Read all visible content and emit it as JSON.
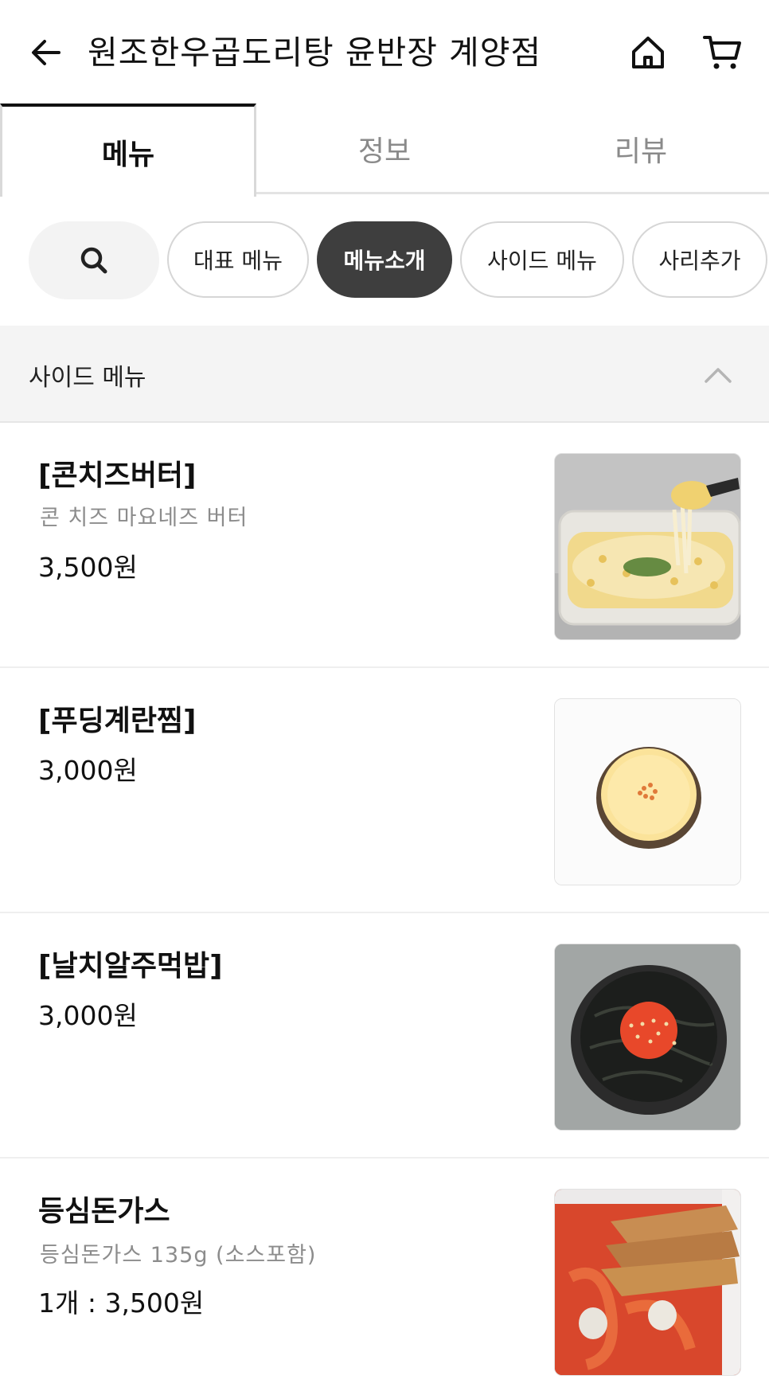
{
  "header": {
    "title": "원조한우곱도리탕 윤반장 계양점",
    "back_icon": "arrow-left-icon",
    "home_icon": "home-icon",
    "cart_icon": "cart-icon"
  },
  "tabs": [
    {
      "label": "메뉴",
      "active": true
    },
    {
      "label": "정보",
      "active": false
    },
    {
      "label": "리뷰",
      "active": false
    }
  ],
  "chips": [
    {
      "label": "대표 메뉴",
      "active": false
    },
    {
      "label": "메뉴소개",
      "active": true
    },
    {
      "label": "사이드 메뉴",
      "active": false
    },
    {
      "label": "사리추가",
      "active": false
    }
  ],
  "section": {
    "title": "사이드 메뉴",
    "collapse_icon": "chevron-up-icon"
  },
  "items": [
    {
      "name": "[콘치즈버터]",
      "desc": "콘 치즈 마요네즈 버터",
      "price": "3,500원",
      "image": "corn-cheese-image"
    },
    {
      "name": "[푸딩계란찜]",
      "desc": "",
      "price": "3,000원",
      "image": "egg-pudding-image"
    },
    {
      "name": "[날치알주먹밥]",
      "desc": "",
      "price": "3,000원",
      "image": "rice-ball-image"
    },
    {
      "name": "등심돈가스",
      "desc": "등심돈가스 135g (소스포함)",
      "price": "1개 : 3,500원",
      "image": "pork-cutlet-image"
    }
  ],
  "colors": {
    "accent_dark": "#3e3e3e",
    "text_primary": "#111111",
    "text_secondary": "#8c8c8c",
    "section_bg": "#f4f4f4"
  }
}
